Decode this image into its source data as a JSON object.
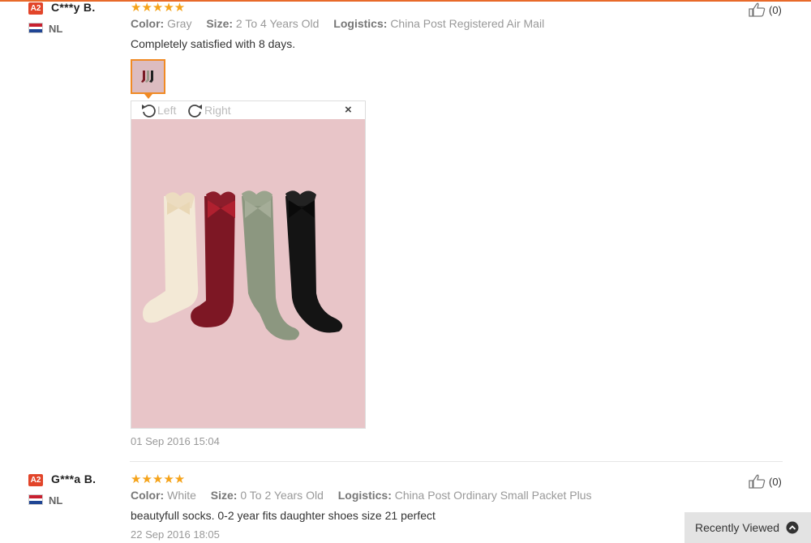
{
  "reviews": [
    {
      "badge": "A2",
      "user": "C***y B.",
      "country": "NL",
      "stars": "★★★★★",
      "color_label": "Color:",
      "color_value": "Gray",
      "size_label": "Size:",
      "size_value": "2 To 4 Years Old",
      "logistics_label": "Logistics:",
      "logistics_value": "China Post Registered Air Mail",
      "comment": "Completely satisfied with 8 days.",
      "helpful_count": "(0)",
      "date": "01 Sep 2016 15:04",
      "viewer": {
        "rotate_left": "Left",
        "rotate_right": "Right",
        "close": "×"
      }
    },
    {
      "badge": "A2",
      "user": "G***a B.",
      "country": "NL",
      "stars": "★★★★★",
      "color_label": "Color:",
      "color_value": "White",
      "size_label": "Size:",
      "size_value": "0 To 2 Years Old",
      "logistics_label": "Logistics:",
      "logistics_value": "China Post Ordinary Small Packet Plus",
      "comment": "beautyfull socks. 0-2 year fits daughter shoes size 21 perfect",
      "helpful_count": "(0)",
      "date": "22 Sep 2016 18:05"
    }
  ],
  "recently_viewed": {
    "label": "Recently Viewed"
  },
  "rating_color": "#f5a31a",
  "accent_color": "#e86a2a",
  "icons": [
    "thumbs-up-icon",
    "rotate-left-icon",
    "rotate-right-icon",
    "close-icon",
    "chevron-up-icon",
    "netherlands-flag-icon"
  ]
}
